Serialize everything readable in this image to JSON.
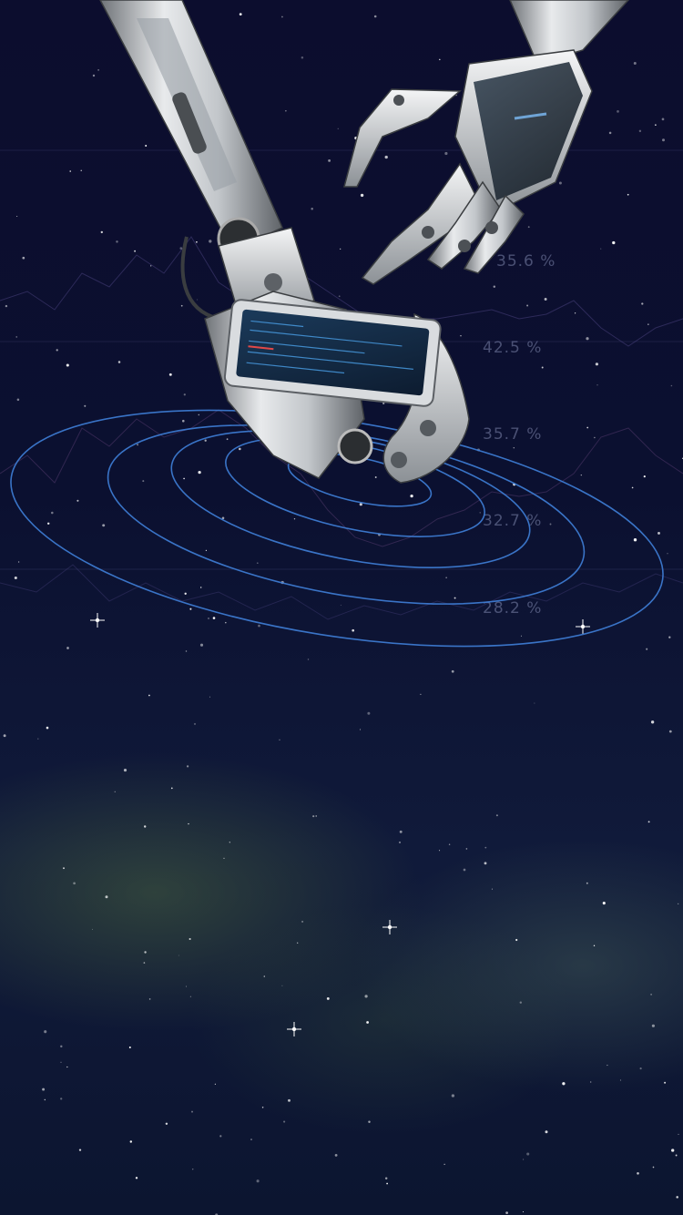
{
  "background": {
    "description_colors": {
      "sky_top": "#0c0d2e",
      "sky_bottom": "#0c1530",
      "nebula": "#4a6a46",
      "orbit_line": "#3e7ed8",
      "chart_line": "#5b4f9a"
    }
  },
  "stock_labels": [
    "35.6 %",
    "42.5 %",
    "35.7 %",
    "32.7 %",
    "28.2 %"
  ]
}
